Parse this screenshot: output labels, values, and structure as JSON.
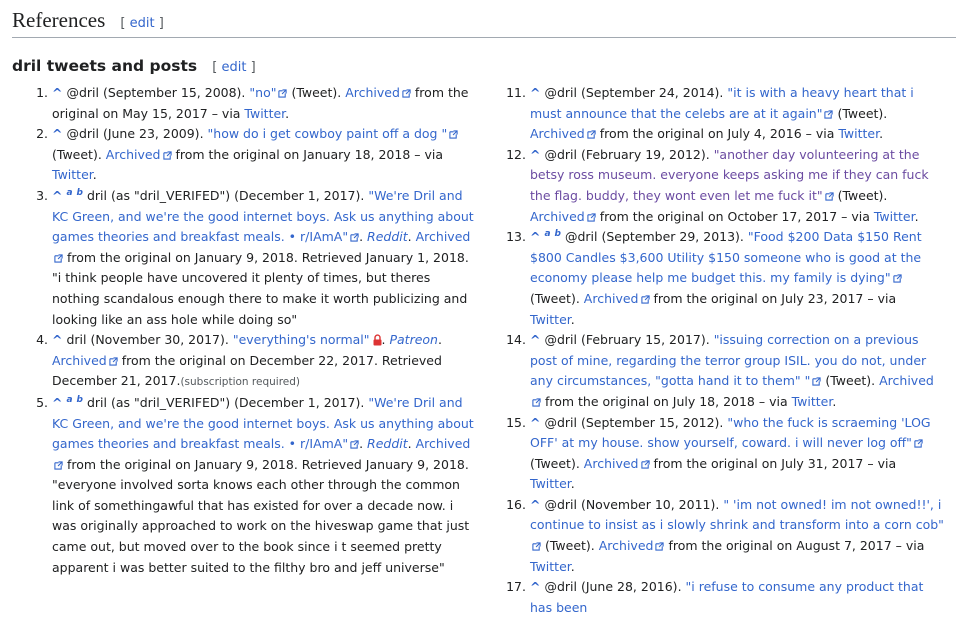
{
  "headings": {
    "references": "References",
    "section": "dril tweets and posts",
    "edit_label": "edit",
    "bracket_open": "[",
    "bracket_close": "]"
  },
  "references": [
    {
      "n": "1.",
      "caret": "^",
      "text_1": " @dril (September 15, 2008). ",
      "title": "\"no\"",
      "text_2": " (Tweet). ",
      "archived": "Archived",
      "text_3": " from the original on May 15, 2017 – via ",
      "via": "Twitter",
      "text_4": "."
    },
    {
      "n": "2.",
      "caret": "^",
      "text_1": " @dril (June 23, 2009). ",
      "title": "\"how do i get cowboy paint off a dog \"",
      "text_2": " (Tweet). ",
      "archived": "Archived",
      "text_3": " from the original on January 18, 2018 – via ",
      "via": "Twitter",
      "text_4": "."
    },
    {
      "n": "3.",
      "caret": "^",
      "sup_a": "a",
      "sup_b": "b",
      "text_1": " dril (as \"dril_VERIFED\") (December 1, 2017). ",
      "title": "\"We're Dril and KC Green, and we're the good internet boys. Ask us anything about games theories and breakfast meals. • r/IAmA\"",
      "text_2": ". ",
      "work": "Reddit",
      "text_5": ". ",
      "archived": "Archived",
      "text_3": " from the original on January 9, 2018. Retrieved January 1, 2018. \"i think people have uncovered it plenty of times, but theres nothing scandalous enough there to make it worth publicizing and looking like an ass hole while doing so\""
    },
    {
      "n": "4.",
      "caret": "^",
      "text_1": " dril (November 30, 2017). ",
      "title": "\"everything's normal\"",
      "text_2": ". ",
      "work": "Patreon",
      "text_5": ". ",
      "archived": "Archived",
      "text_3": " from the original on December 22, 2017. Retrieved December 21, 2017.",
      "sub": "(subscription required)"
    },
    {
      "n": "5.",
      "caret": "^",
      "sup_a": "a",
      "sup_b": "b",
      "text_1": " dril (as \"dril_VERIFED\") (December 1, 2017). ",
      "title": "\"We're Dril and KC Green, and we're the good internet boys. Ask us anything about games theories and breakfast meals. • r/IAmA\"",
      "text_2": ". ",
      "work": "Reddit",
      "text_5": ". ",
      "archived": "Archived",
      "text_3": " from the original on January 9, 2018. Retrieved January 9, 2018. \"everyone involved sorta knows each other through the common link of somethingawful that has existed for over a decade now. i was originally approached to work on the hiveswap game that just came out, but moved over to the book since i t seemed pretty apparent i was better suited to the filthy bro and jeff universe\""
    },
    {
      "n": "11.",
      "caret": "^",
      "text_1": " @dril (September 24, 2014). ",
      "title": "\"it is with a heavy heart that i must announce that the celebs are at it again\"",
      "text_2": " (Tweet). ",
      "archived": "Archived",
      "text_3": " from the original on July 4, 2016 – via ",
      "via": "Twitter",
      "text_4": "."
    },
    {
      "n": "12.",
      "caret": "^",
      "text_1": " @dril (February 19, 2012). ",
      "title": "\"another day volunteering at the betsy ross museum. everyone keeps asking me if they can fuck the flag. buddy, they wont even let me fuck it\"",
      "text_2": " (Tweet). ",
      "archived": "Archived",
      "text_3": " from the original on October 17, 2017 – via ",
      "via": "Twitter",
      "text_4": "."
    },
    {
      "n": "13.",
      "caret": "^",
      "sup_a": "a",
      "sup_b": "b",
      "text_1": " @dril (September 29, 2013). ",
      "title": "\"Food $200 Data $150 Rent $800 Candles $3,600 Utility $150 someone who is good at the economy please help me budget this. my family is dying\"",
      "text_2": " (Tweet). ",
      "archived": "Archived",
      "text_3": " from the original on July 23, 2017 – via ",
      "via": "Twitter",
      "text_4": "."
    },
    {
      "n": "14.",
      "caret": "^",
      "text_1": " @dril (February 15, 2017). ",
      "title": "\"issuing correction on a previous post of mine, regarding the terror group ISIL. you do not, under any circumstances, \"gotta hand it to them\" \"",
      "text_2": " (Tweet). ",
      "archived": "Archived",
      "text_3": " from the original on July 18, 2018 – via ",
      "via": "Twitter",
      "text_4": "."
    },
    {
      "n": "15.",
      "caret": "^",
      "text_1": " @dril (September 15, 2012). ",
      "title": "\"who the fuck is scraeming 'LOG OFF' at my house. show yourself, coward. i will never log off\"",
      "text_2": " (Tweet). ",
      "archived": "Archived",
      "text_3": " from the original on July 31, 2017 – via ",
      "via": "Twitter",
      "text_4": "."
    },
    {
      "n": "16.",
      "caret": "^",
      "text_1": " @dril (November 10, 2011). ",
      "title": "\" 'im not owned! im not owned!!', i continue to insist as i slowly shrink and transform into a corn cob\"",
      "text_2": " (Tweet). ",
      "archived": "Archived",
      "text_3": " from the original on August 7, 2017 – via ",
      "via": "Twitter",
      "text_4": "."
    },
    {
      "n": "17.",
      "caret": "^",
      "text_1": " @dril (June 28, 2016). ",
      "title": "\"i refuse to consume any product that has been"
    }
  ]
}
